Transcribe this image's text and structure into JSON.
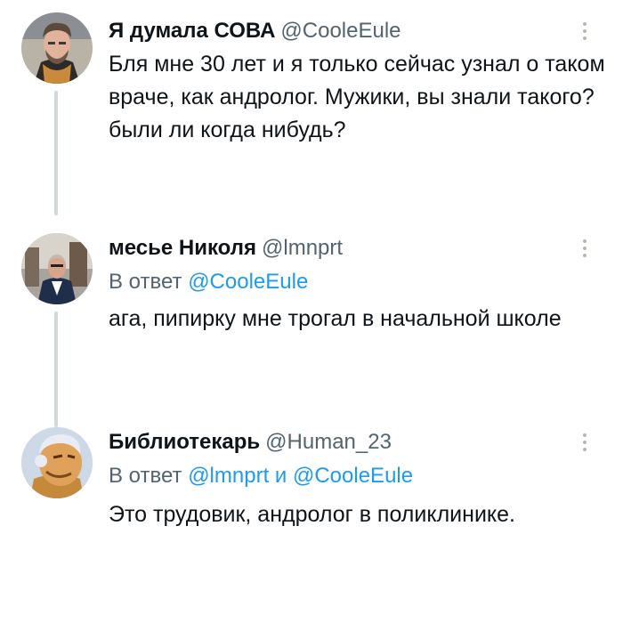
{
  "tweets": [
    {
      "name": "Я думала СОВА",
      "handle": "@CooleEule",
      "text": "Бля мне 30 лет и я только сейчас узнал о таком враче, как андролог. Мужики, вы знали такого? были ли когда нибудь?"
    },
    {
      "name": "месье Николя",
      "handle": "@lmnprt",
      "reply_prefix": "В ответ",
      "reply_mention1": "@CooleEule",
      "text": "ага, пипирку мне трогал в начальной школе"
    },
    {
      "name": "Библиотекарь",
      "handle": "@Human_23",
      "reply_prefix": "В ответ",
      "reply_mention1": "@lmnprt",
      "reply_and": "и",
      "reply_mention2": "@CooleEule",
      "text": "Это трудовик, андролог в поликлинике."
    }
  ],
  "icons": {
    "more": "more-vertical-icon"
  },
  "colors": {
    "mention": "#1d9bf0",
    "secondary": "#536471",
    "thread_line": "#cfd9de"
  }
}
